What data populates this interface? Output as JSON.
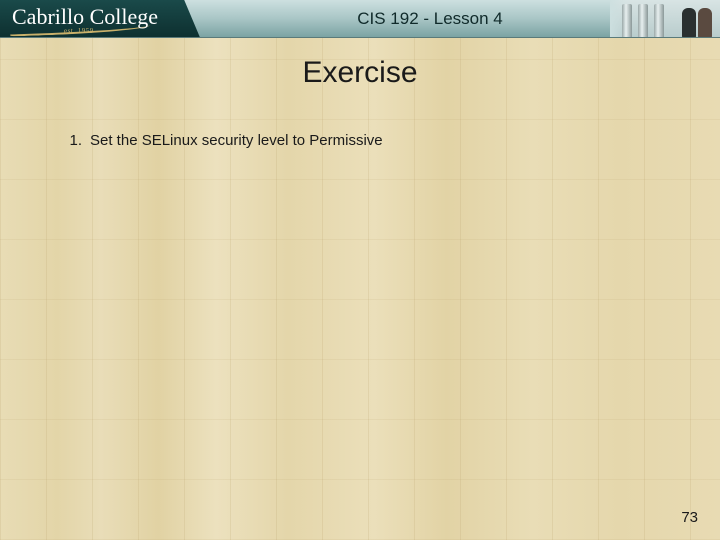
{
  "header": {
    "logo_text": "Cabrillo College",
    "logo_sub": "est. 1959",
    "course_title": "CIS 192 - Lesson 4"
  },
  "slide": {
    "title": "Exercise",
    "items": [
      {
        "num": "1.",
        "text": "Set the SELinux security level to Permissive"
      }
    ]
  },
  "page_number": "73"
}
